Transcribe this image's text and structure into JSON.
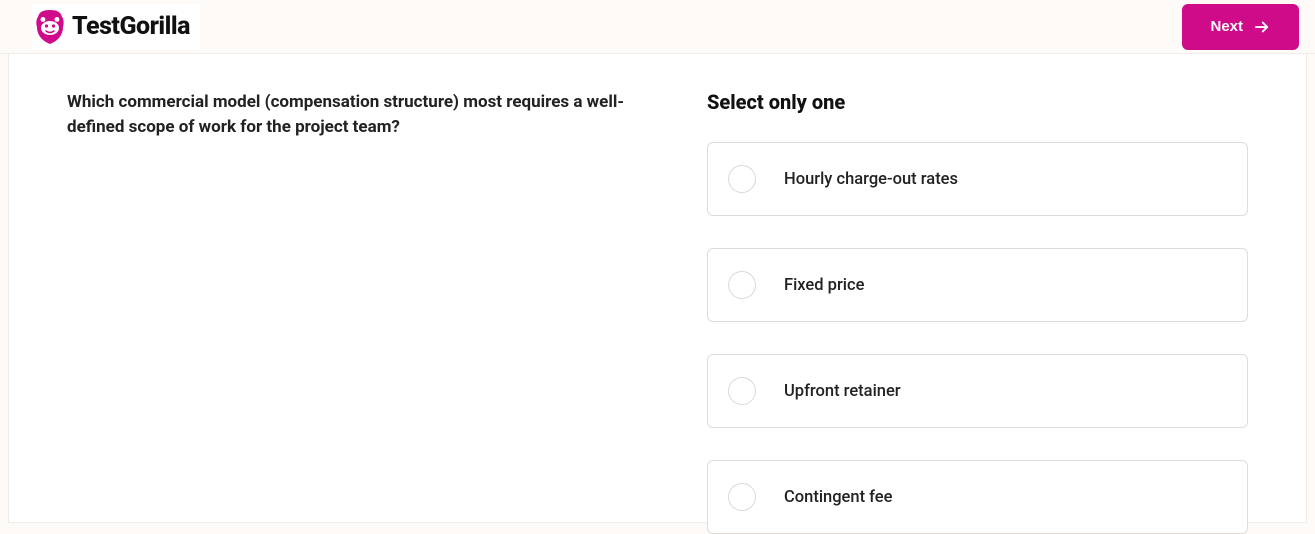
{
  "brand": {
    "name": "TestGorilla",
    "accent": "#cf0b8a"
  },
  "header": {
    "next_label": "Next"
  },
  "question": {
    "prompt": "Which commercial model (compensation structure) most requires a well-defined scope of work for the project team?",
    "instruction": "Select only one",
    "options": [
      {
        "label": "Hourly charge-out rates"
      },
      {
        "label": "Fixed price"
      },
      {
        "label": "Upfront retainer"
      },
      {
        "label": "Contingent fee"
      }
    ]
  }
}
